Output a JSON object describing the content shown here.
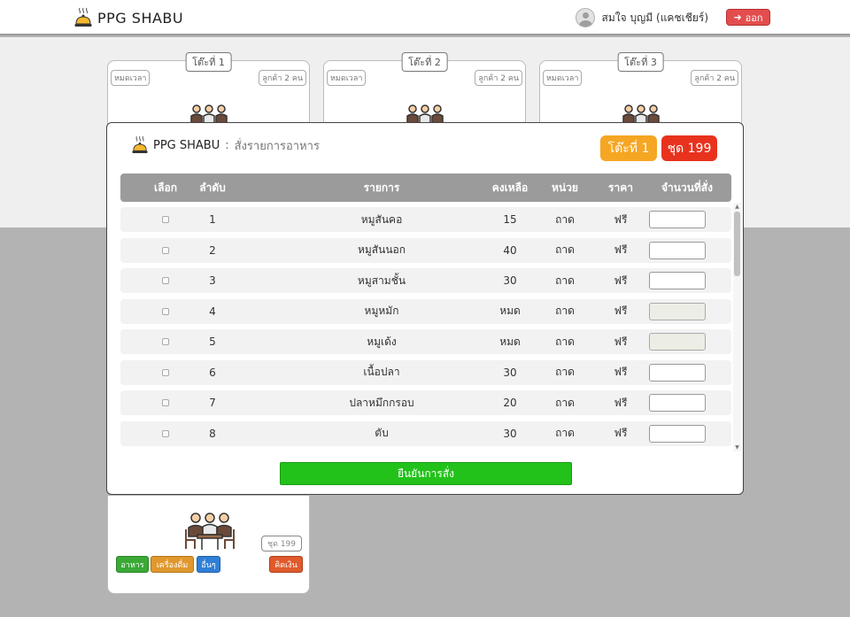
{
  "app": {
    "brand": "PPG SHABU"
  },
  "user": {
    "name": "สมใจ บุญมี (แคชเชียร์)",
    "logout_label": "ออก"
  },
  "tables": [
    {
      "title": "โต๊ะที่ 1",
      "status": "หมดเวลา",
      "guests": "ลูกค้า 2 คน"
    },
    {
      "title": "โต๊ะที่ 2",
      "status": "หมดเวลา",
      "guests": "ลูกค้า 2 คน"
    },
    {
      "title": "โต๊ะที่ 3",
      "status": "หมดเวลา",
      "guests": "ลูกค้า 2 คน"
    }
  ],
  "card4": {
    "pack": "ชุด 199",
    "buttons": {
      "food": "อาหาร",
      "drinks": "เครื่องดื่ม",
      "other": "อื่นๆ",
      "checkout": "คิดเงิน"
    }
  },
  "colors": {
    "food": "#3aa935",
    "drinks": "#e0982e",
    "other": "#2f7fd6",
    "checkout": "#e05a2b"
  },
  "modal": {
    "brand": "PPG SHABU",
    "separator": ":",
    "title": "สั่งรายการอาหาร",
    "table_badge": "โต๊ะที่ 1",
    "pack_badge": "ชุด 199",
    "headers": {
      "select": "เลือก",
      "no": "ลำดับ",
      "name": "รายการ",
      "left": "คงเหลือ",
      "unit": "หน่วย",
      "price": "ราคา",
      "qty": "จำนวนที่สั่ง"
    },
    "rows": [
      {
        "no": "1",
        "name": "หมูสันคอ",
        "left": "15",
        "unit": "ถาด",
        "price": "ฟรี",
        "qty": ""
      },
      {
        "no": "2",
        "name": "หมูสันนอก",
        "left": "40",
        "unit": "ถาด",
        "price": "ฟรี",
        "qty": ""
      },
      {
        "no": "3",
        "name": "หมูสามชั้น",
        "left": "30",
        "unit": "ถาด",
        "price": "ฟรี",
        "qty": ""
      },
      {
        "no": "4",
        "name": "หมูหมัก",
        "left": "หมด",
        "unit": "ถาด",
        "price": "ฟรี",
        "qty": ""
      },
      {
        "no": "5",
        "name": "หมูเด้ง",
        "left": "หมด",
        "unit": "ถาด",
        "price": "ฟรี",
        "qty": ""
      },
      {
        "no": "6",
        "name": "เนื้อปลา",
        "left": "30",
        "unit": "ถาด",
        "price": "ฟรี",
        "qty": ""
      },
      {
        "no": "7",
        "name": "ปลาหมึกกรอบ",
        "left": "20",
        "unit": "ถาด",
        "price": "ฟรี",
        "qty": ""
      },
      {
        "no": "8",
        "name": "ตับ",
        "left": "30",
        "unit": "ถาด",
        "price": "ฟรี",
        "qty": ""
      }
    ],
    "confirm_label": "ยืนยันการสั่ง"
  }
}
